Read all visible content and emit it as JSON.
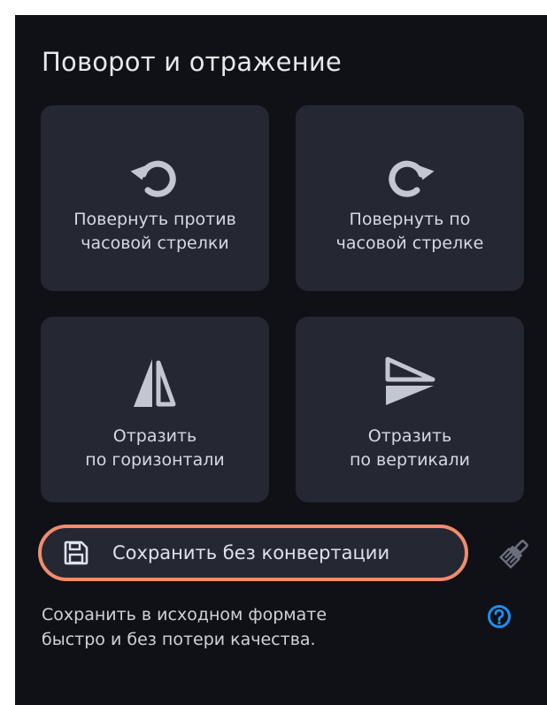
{
  "panel": {
    "title": "Поворот и отражение"
  },
  "tiles": [
    {
      "label": "Повернуть против\nчасовой стрелки",
      "icon": "rotate-ccw-icon"
    },
    {
      "label": "Повернуть по\nчасовой стрелке",
      "icon": "rotate-cw-icon"
    },
    {
      "label": "Отразить\nпо горизонтали",
      "icon": "flip-horizontal-icon"
    },
    {
      "label": "Отразить\nпо вертикали",
      "icon": "flip-vertical-icon"
    }
  ],
  "save_button": {
    "label": "Сохранить без конвертации",
    "icon": "floppy-disk-icon"
  },
  "hint": {
    "text": "Сохранить в исходном формате\nбыстро и без потери качества."
  },
  "icons": {
    "brush": "brush-icon",
    "help": "help-icon"
  },
  "colors": {
    "panel_bg": "#101117",
    "tile_bg": "#252733",
    "highlight_border": "#ef8d6d",
    "help_accent": "#1e8ff0",
    "text": "#d6d9e2"
  }
}
